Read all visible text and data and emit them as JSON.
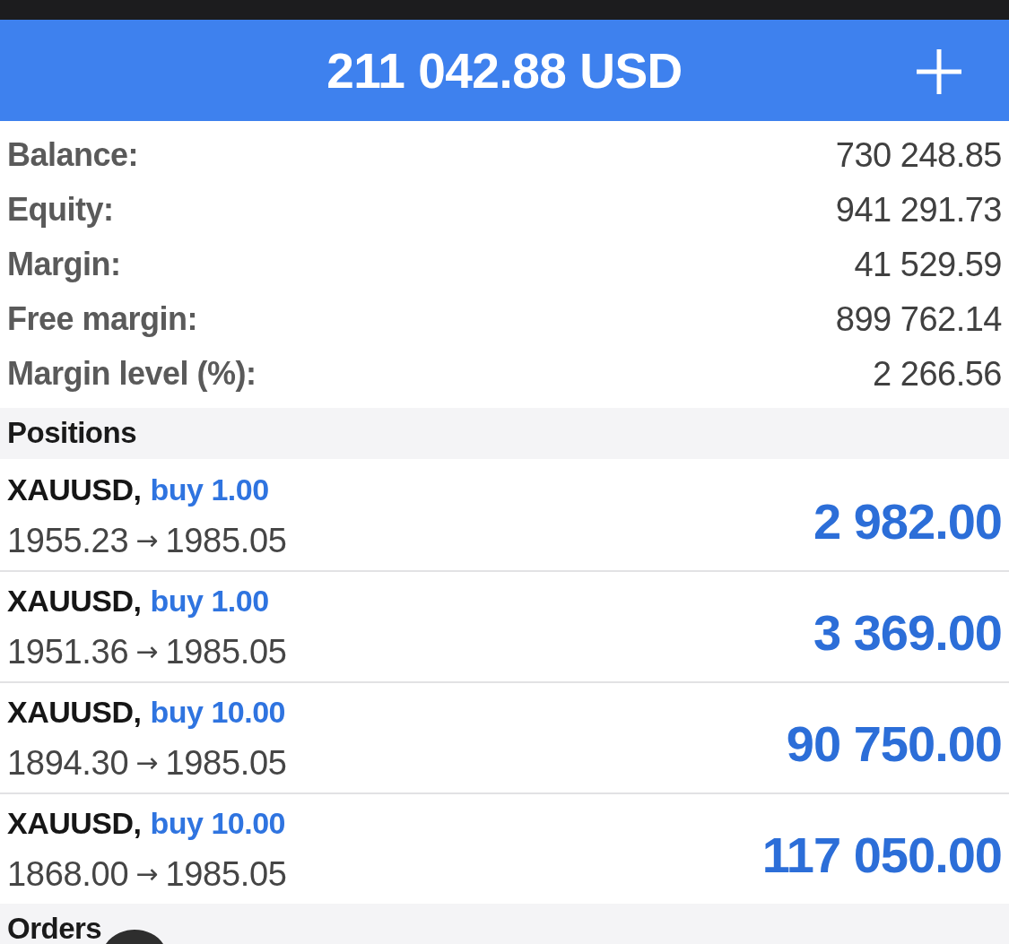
{
  "header": {
    "title": "211 042.88 USD"
  },
  "summary": [
    {
      "label": "Balance:",
      "value": "730 248.85"
    },
    {
      "label": "Equity:",
      "value": "941 291.73"
    },
    {
      "label": "Margin:",
      "value": "41 529.59"
    },
    {
      "label": "Free margin:",
      "value": "899 762.14"
    },
    {
      "label": "Margin level (%):",
      "value": "2 266.56"
    }
  ],
  "sections": [
    {
      "title": "Positions",
      "positions": [
        {
          "symbol": "XAUUSD,",
          "trade": "buy 1.00",
          "open_price": "1955.23",
          "arrow": "→",
          "current_price": "1985.05",
          "profit": "2 982.00"
        },
        {
          "symbol": "XAUUSD,",
          "trade": "buy 1.00",
          "open_price": "1951.36",
          "arrow": "→",
          "current_price": "1985.05",
          "profit": "3 369.00"
        },
        {
          "symbol": "XAUUSD,",
          "trade": "buy 10.00",
          "open_price": "1894.30",
          "arrow": "→",
          "current_price": "1985.05",
          "profit": "90 750.00"
        },
        {
          "symbol": "XAUUSD,",
          "trade": "buy 10.00",
          "open_price": "1868.00",
          "arrow": "→",
          "current_price": "1985.05",
          "profit": "117 050.00"
        }
      ]
    },
    {
      "title": "Orders"
    }
  ]
}
